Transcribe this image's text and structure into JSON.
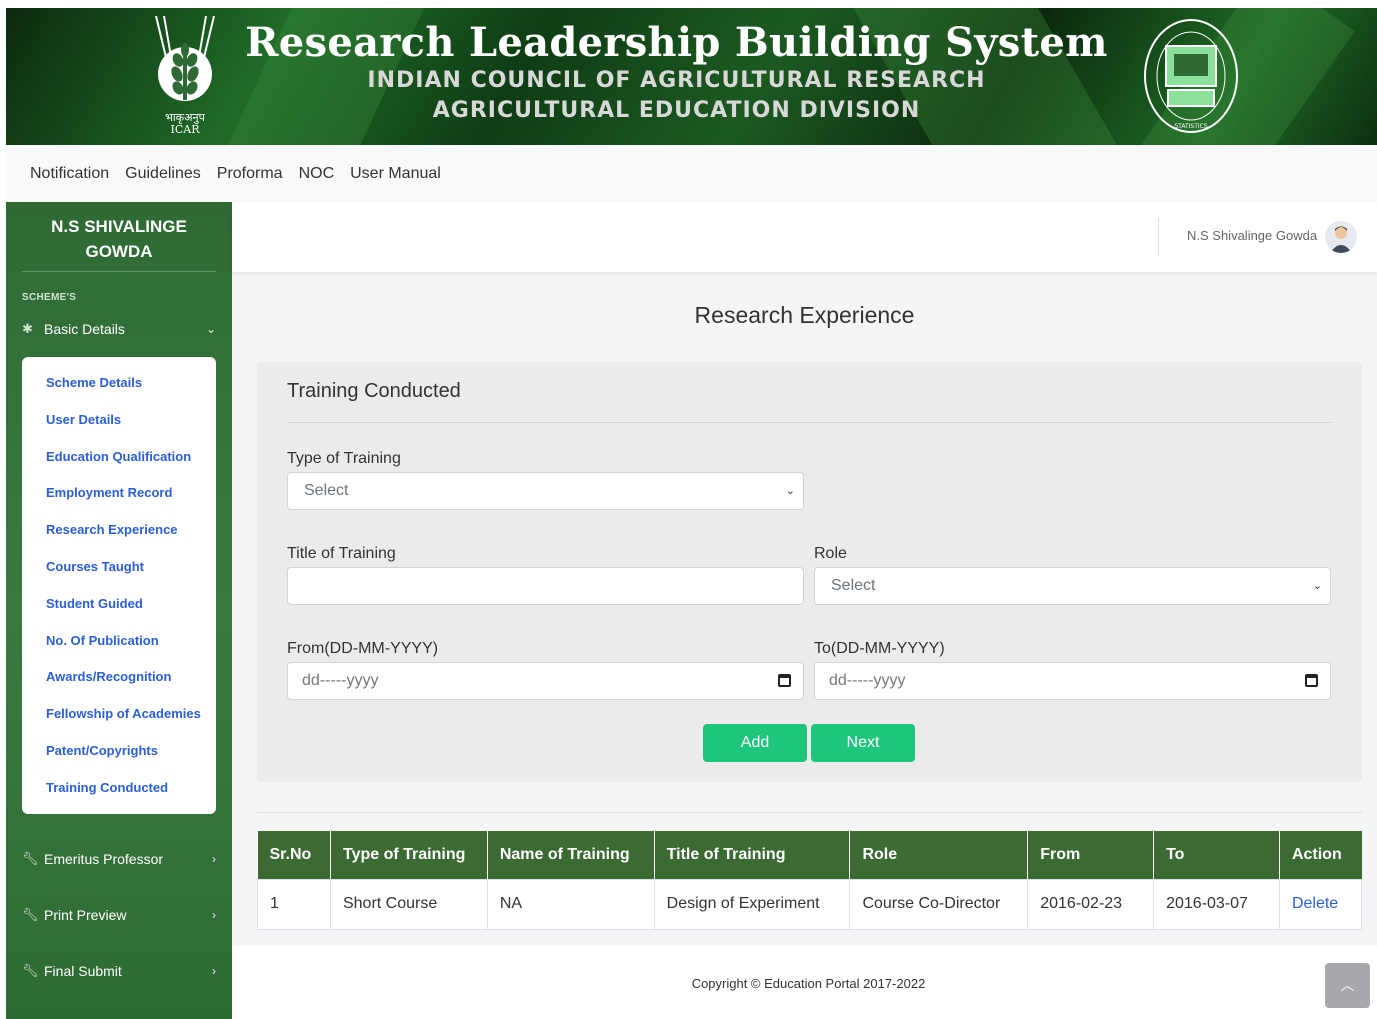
{
  "header": {
    "title": "Research Leadership Building System",
    "line2": "INDIAN COUNCIL OF AGRICULTURAL RESEARCH",
    "line3": "AGRICULTURAL EDUCATION DIVISION",
    "left_logo_text_hindi": "भाकृअनुप",
    "left_logo_text": "ICAR",
    "right_logo_ring_text": "भारतीय कृषि सांख्यिकी अनुसंधान संस्थान • INDIAN AGRICULTURAL STATISTICS RESEARCH INSTITUTE"
  },
  "topnav": [
    "Notification",
    "Guidelines",
    "Proforma",
    "NOC",
    "User Manual"
  ],
  "sidebar": {
    "user_name": "N.S SHIVALINGE GOWDA",
    "section_label": "SCHEME'S",
    "basic_details": "Basic Details",
    "submenu": [
      "Scheme Details",
      "User Details",
      "Education Qualification",
      "Employment Record",
      "Research Experience",
      "Courses Taught",
      "Student Guided",
      "No. Of Publication",
      "Awards/Recognition",
      "Fellowship of Academies",
      "Patent/Copyrights",
      "Training Conducted"
    ],
    "emeritus": "Emeritus Professor",
    "print_preview": "Print Preview",
    "final_submit": "Final Submit"
  },
  "topbar": {
    "user_name": "N.S Shivalinge Gowda"
  },
  "page_title": "Research Experience",
  "form": {
    "title": "Training Conducted",
    "type_label": "Type of Training",
    "type_value": "Select",
    "title_label": "Title of Training",
    "title_value": "",
    "role_label": "Role",
    "role_value": "Select",
    "from_label": "From(DD-MM-YYYY)",
    "from_value": "dd-----yyyy",
    "to_label": "To(DD-MM-YYYY)",
    "to_value": "dd-----yyyy",
    "add_label": "Add",
    "next_label": "Next"
  },
  "table": {
    "headers": [
      "Sr.No",
      "Type of Training",
      "Name of Training",
      "Title of Training",
      "Role",
      "From",
      "To",
      "Action"
    ],
    "rows": [
      [
        "1",
        "Short Course",
        "NA",
        "Design of Experiment",
        "Course Co-Director",
        "2016-02-23",
        "2016-03-07",
        "Delete"
      ]
    ]
  },
  "footer": {
    "copyright": "Copyright © Education Portal 2017-2022"
  },
  "icons": {
    "basic_details": "gear-icon",
    "emeritus": "wrench-icon",
    "print_preview": "wrench-icon",
    "final_submit": "wrench-icon",
    "scroll_top": "chevron-up-icon"
  },
  "colors": {
    "sidebar": "#3a7a3f",
    "table_header": "#3b6b32",
    "button": "#1ec57d",
    "link": "#2b5fd9"
  }
}
